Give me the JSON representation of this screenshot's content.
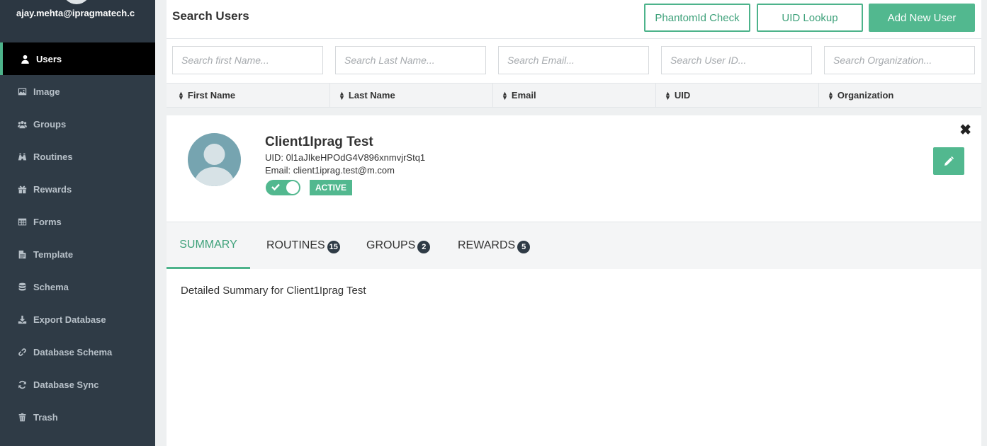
{
  "sidebar": {
    "email": "ajay.mehta@ipragmatech.c",
    "items": [
      {
        "label": "Users",
        "icon": "user-icon"
      },
      {
        "label": "Image",
        "icon": "image-icon"
      },
      {
        "label": "Groups",
        "icon": "groups-icon"
      },
      {
        "label": "Routines",
        "icon": "routines-icon"
      },
      {
        "label": "Rewards",
        "icon": "gift-icon"
      },
      {
        "label": "Forms",
        "icon": "table-icon"
      },
      {
        "label": "Template",
        "icon": "file-icon"
      },
      {
        "label": "Schema",
        "icon": "database-icon"
      },
      {
        "label": "Export Database",
        "icon": "download-icon"
      },
      {
        "label": "Database Schema",
        "icon": "link-icon"
      },
      {
        "label": "Database Sync",
        "icon": "refresh-icon"
      },
      {
        "label": "Trash",
        "icon": "trash-icon"
      }
    ]
  },
  "header": {
    "title": "Search Users",
    "phantom_label": "PhantomId Check",
    "uid_label": "UID Lookup",
    "add_label": "Add New User"
  },
  "filters": {
    "first_name": "Search first Name...",
    "last_name": "Search Last Name...",
    "email": "Search Email...",
    "user_id": "Search User ID...",
    "organization": "Search Organization..."
  },
  "columns": [
    "First Name",
    "Last Name",
    "Email",
    "UID",
    "Organization"
  ],
  "user": {
    "name": "Client1Iprag Test",
    "uid": "UID: 0l1aJIkeHPOdG4V896xnmvjrStq1",
    "email": "Email: client1iprag.test@m.com",
    "status": "ACTIVE",
    "active": true
  },
  "tabs": [
    {
      "label": "SUMMARY",
      "count": ""
    },
    {
      "label": "ROUTINES",
      "count": "15"
    },
    {
      "label": "GROUPS",
      "count": "2"
    },
    {
      "label": "REWARDS",
      "count": "5"
    }
  ],
  "summary": {
    "text": "Detailed Summary for Client1Iprag Test"
  },
  "colors": {
    "accent": "#52b88f",
    "sidebar": "#2f3b46"
  }
}
